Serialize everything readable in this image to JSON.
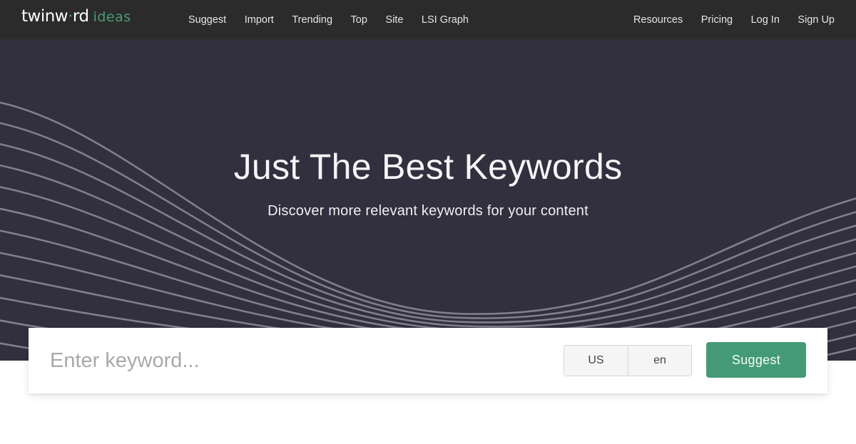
{
  "brand": {
    "logo_main": "twinw",
    "logo_dot": "·",
    "logo_tail": "rd",
    "logo_sub": "ideas",
    "accent_color": "#459a76"
  },
  "nav": {
    "left": [
      {
        "label": "Suggest"
      },
      {
        "label": "Import"
      },
      {
        "label": "Trending"
      },
      {
        "label": "Top"
      },
      {
        "label": "Site"
      },
      {
        "label": "LSI Graph"
      }
    ],
    "right": [
      {
        "label": "Resources"
      },
      {
        "label": "Pricing"
      },
      {
        "label": "Log In"
      },
      {
        "label": "Sign Up"
      }
    ]
  },
  "hero": {
    "title": "Just The Best Keywords",
    "subtitle": "Discover more relevant keywords for your content",
    "background_color": "#322f3e",
    "wave_color": "#8a8796"
  },
  "search": {
    "input_value": "",
    "input_placeholder": "Enter keyword...",
    "country": "US",
    "language": "en",
    "submit_label": "Suggest"
  }
}
